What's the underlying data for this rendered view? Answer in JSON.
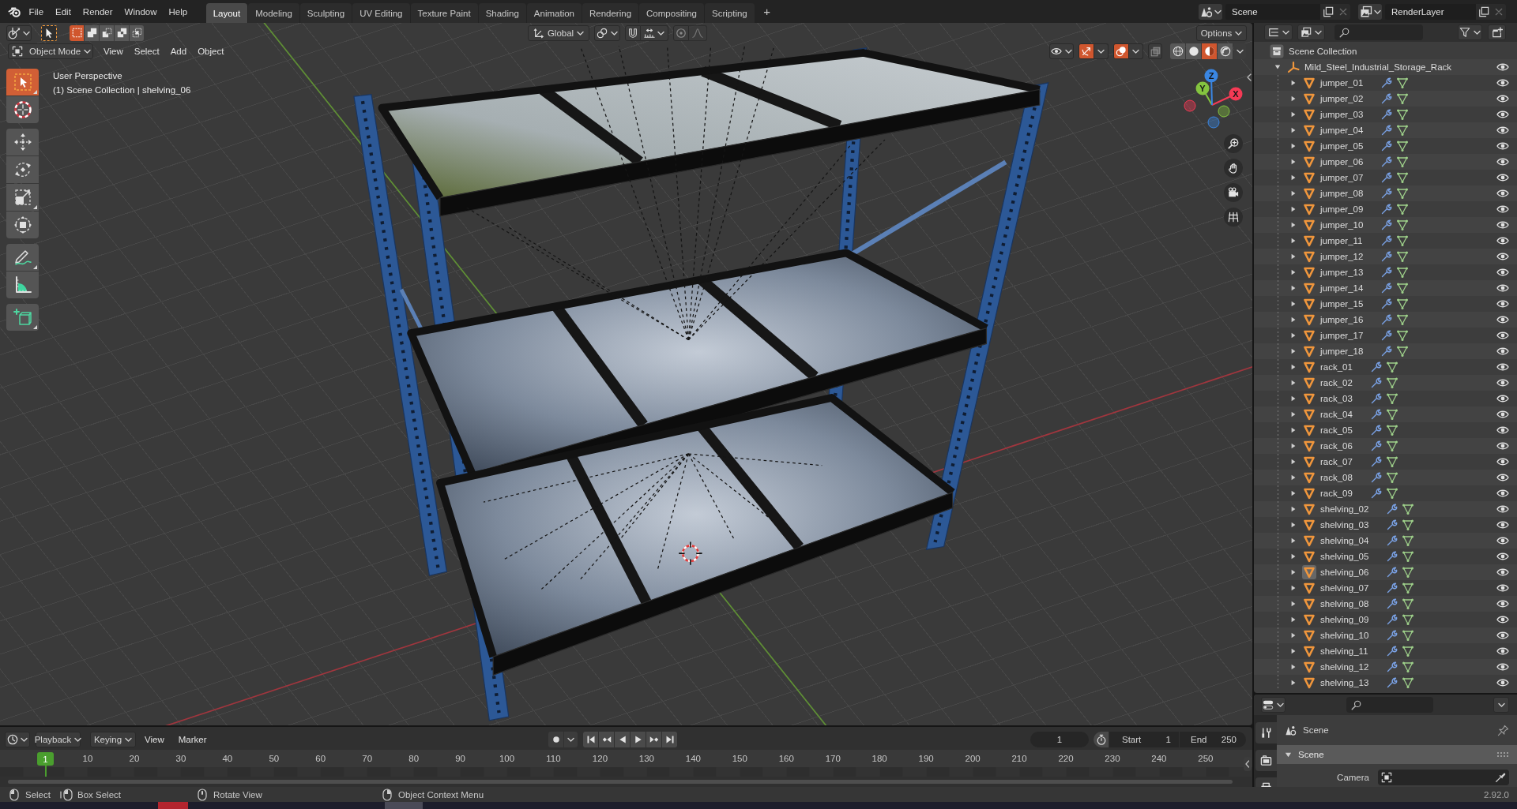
{
  "top_bar": {
    "menus": [
      "File",
      "Edit",
      "Render",
      "Window",
      "Help"
    ],
    "workspaces": [
      {
        "label": "Layout",
        "selected": true
      },
      {
        "label": "Modeling",
        "selected": false
      },
      {
        "label": "Sculpting",
        "selected": false
      },
      {
        "label": "UV Editing",
        "selected": false
      },
      {
        "label": "Texture Paint",
        "selected": false
      },
      {
        "label": "Shading",
        "selected": false
      },
      {
        "label": "Animation",
        "selected": false
      },
      {
        "label": "Rendering",
        "selected": false
      },
      {
        "label": "Compositing",
        "selected": false
      },
      {
        "label": "Scripting",
        "selected": false
      }
    ],
    "add_workspace": "+",
    "scene": "Scene",
    "view_layer": "RenderLayer"
  },
  "viewport": {
    "tool_header": {
      "select_modes": [
        {
          "kind": "set",
          "selected": true
        },
        {
          "kind": "extend",
          "selected": false
        },
        {
          "kind": "subtract",
          "selected": false
        },
        {
          "kind": "invert",
          "selected": false
        },
        {
          "kind": "intersect",
          "selected": false
        }
      ],
      "orientation": "Global",
      "snapping": false,
      "proportional_editing": false,
      "options": "Options"
    },
    "header": {
      "mode": "Object Mode",
      "menus": [
        "View",
        "Select",
        "Add",
        "Object"
      ],
      "gizmos": true,
      "overlays": true,
      "xray": false,
      "shading": [
        {
          "kind": "wireframe",
          "selected": false
        },
        {
          "kind": "solid",
          "selected": false
        },
        {
          "kind": "material",
          "selected": true
        },
        {
          "kind": "rendered",
          "selected": false
        }
      ]
    },
    "info": [
      "User Perspective",
      "(1) Scene Collection | shelving_06"
    ],
    "toolbar": [
      {
        "tools": [
          {
            "kind": "select_box",
            "selected": true
          },
          {
            "kind": "cursor",
            "selected": false
          }
        ]
      },
      {
        "tools": [
          {
            "kind": "move",
            "selected": false
          },
          {
            "kind": "rotate",
            "selected": false
          },
          {
            "kind": "scale",
            "selected": false
          },
          {
            "kind": "transform",
            "selected": false
          }
        ]
      },
      {
        "tools": [
          {
            "kind": "annotate",
            "selected": false
          },
          {
            "kind": "measure",
            "selected": false
          }
        ]
      },
      {
        "tools": [
          {
            "kind": "add_cube",
            "selected": false
          }
        ]
      }
    ],
    "gizmo_axes": [
      {
        "kind": "x",
        "label": "X",
        "color": "#f53a55"
      },
      {
        "kind": "y",
        "label": "Y",
        "color": "#84c43f"
      },
      {
        "kind": "z",
        "label": "Z",
        "color": "#3a86e2"
      }
    ],
    "nav_buttons": [
      {
        "kind": "zoom"
      },
      {
        "kind": "pan"
      },
      {
        "kind": "camera"
      },
      {
        "kind": "ortho"
      }
    ]
  },
  "outliner": {
    "root": {
      "name": "Scene Collection",
      "children": [
        {
          "name": "Mild_Steel_Industrial_Storage_Rack",
          "kind": "empty",
          "expanded": true,
          "visible": true,
          "children": [
            {
              "name": "jumper_01",
              "kind": "mesh",
              "expanded": false,
              "active": false,
              "visible": true
            },
            {
              "name": "jumper_02",
              "kind": "mesh",
              "expanded": false,
              "active": false,
              "visible": true
            },
            {
              "name": "jumper_03",
              "kind": "mesh",
              "expanded": false,
              "active": false,
              "visible": true
            },
            {
              "name": "jumper_04",
              "kind": "mesh",
              "expanded": false,
              "active": false,
              "visible": true
            },
            {
              "name": "jumper_05",
              "kind": "mesh",
              "expanded": false,
              "active": false,
              "visible": true
            },
            {
              "name": "jumper_06",
              "kind": "mesh",
              "expanded": false,
              "active": false,
              "visible": true
            },
            {
              "name": "jumper_07",
              "kind": "mesh",
              "expanded": false,
              "active": false,
              "visible": true
            },
            {
              "name": "jumper_08",
              "kind": "mesh",
              "expanded": false,
              "active": false,
              "visible": true
            },
            {
              "name": "jumper_09",
              "kind": "mesh",
              "expanded": false,
              "active": false,
              "visible": true
            },
            {
              "name": "jumper_10",
              "kind": "mesh",
              "expanded": false,
              "active": false,
              "visible": true
            },
            {
              "name": "jumper_11",
              "kind": "mesh",
              "expanded": false,
              "active": false,
              "visible": true
            },
            {
              "name": "jumper_12",
              "kind": "mesh",
              "expanded": false,
              "active": false,
              "visible": true
            },
            {
              "name": "jumper_13",
              "kind": "mesh",
              "expanded": false,
              "active": false,
              "visible": true
            },
            {
              "name": "jumper_14",
              "kind": "mesh",
              "expanded": false,
              "active": false,
              "visible": true
            },
            {
              "name": "jumper_15",
              "kind": "mesh",
              "expanded": false,
              "active": false,
              "visible": true
            },
            {
              "name": "jumper_16",
              "kind": "mesh",
              "expanded": false,
              "active": false,
              "visible": true
            },
            {
              "name": "jumper_17",
              "kind": "mesh",
              "expanded": false,
              "active": false,
              "visible": true
            },
            {
              "name": "jumper_18",
              "kind": "mesh",
              "expanded": false,
              "active": false,
              "visible": true
            },
            {
              "name": "rack_01",
              "kind": "mesh",
              "expanded": false,
              "active": false,
              "visible": true
            },
            {
              "name": "rack_02",
              "kind": "mesh",
              "expanded": false,
              "active": false,
              "visible": true
            },
            {
              "name": "rack_03",
              "kind": "mesh",
              "expanded": false,
              "active": false,
              "visible": true
            },
            {
              "name": "rack_04",
              "kind": "mesh",
              "expanded": false,
              "active": false,
              "visible": true
            },
            {
              "name": "rack_05",
              "kind": "mesh",
              "expanded": false,
              "active": false,
              "visible": true
            },
            {
              "name": "rack_06",
              "kind": "mesh",
              "expanded": false,
              "active": false,
              "visible": true
            },
            {
              "name": "rack_07",
              "kind": "mesh",
              "expanded": false,
              "active": false,
              "visible": true
            },
            {
              "name": "rack_08",
              "kind": "mesh",
              "expanded": false,
              "active": false,
              "visible": true
            },
            {
              "name": "rack_09",
              "kind": "mesh",
              "expanded": false,
              "active": false,
              "visible": true
            },
            {
              "name": "shelving_02",
              "kind": "mesh",
              "expanded": false,
              "active": false,
              "visible": true
            },
            {
              "name": "shelving_03",
              "kind": "mesh",
              "expanded": false,
              "active": false,
              "visible": true
            },
            {
              "name": "shelving_04",
              "kind": "mesh",
              "expanded": false,
              "active": false,
              "visible": true
            },
            {
              "name": "shelving_05",
              "kind": "mesh",
              "expanded": false,
              "active": false,
              "visible": true
            },
            {
              "name": "shelving_06",
              "kind": "mesh",
              "expanded": false,
              "active": true,
              "visible": true
            },
            {
              "name": "shelving_07",
              "kind": "mesh",
              "expanded": false,
              "active": false,
              "visible": true
            },
            {
              "name": "shelving_08",
              "kind": "mesh",
              "expanded": false,
              "active": false,
              "visible": true
            },
            {
              "name": "shelving_09",
              "kind": "mesh",
              "expanded": false,
              "active": false,
              "visible": true
            },
            {
              "name": "shelving_10",
              "kind": "mesh",
              "expanded": false,
              "active": false,
              "visible": true
            },
            {
              "name": "shelving_11",
              "kind": "mesh",
              "expanded": false,
              "active": false,
              "visible": true
            },
            {
              "name": "shelving_12",
              "kind": "mesh",
              "expanded": false,
              "active": false,
              "visible": true
            },
            {
              "name": "shelving_13",
              "kind": "mesh",
              "expanded": false,
              "active": false,
              "visible": true
            }
          ]
        }
      ]
    }
  },
  "properties": {
    "tabs": [
      {
        "kind": "tool",
        "selected": false
      },
      {
        "kind": "render",
        "selected": false
      },
      {
        "kind": "output",
        "selected": false
      }
    ],
    "context": "Scene",
    "panel": {
      "title": "Scene",
      "expanded": true
    },
    "fields": [
      {
        "label": "Camera"
      }
    ]
  },
  "timeline": {
    "menus": [
      {
        "kind": "dropdown",
        "label": "Playback"
      },
      {
        "kind": "dropdown",
        "label": "Keying"
      },
      {
        "kind": "menu",
        "label": "View"
      },
      {
        "kind": "menu",
        "label": "Marker"
      }
    ],
    "auto_keying": false,
    "current_frame": "1",
    "start": {
      "label": "Start",
      "value": "1"
    },
    "end": {
      "label": "End",
      "value": "250"
    },
    "playhead": "1",
    "frame_labels": [
      "10",
      "20",
      "30",
      "40",
      "50",
      "60",
      "70",
      "80",
      "90",
      "100",
      "110",
      "120",
      "130",
      "140",
      "150",
      "160",
      "170",
      "180",
      "190",
      "200",
      "210",
      "220",
      "230",
      "240",
      "250"
    ]
  },
  "status_bar": {
    "hints": [
      {
        "kind": "left_click",
        "label": "Select"
      },
      {
        "kind": "left_drag",
        "label": "Box Select"
      },
      {
        "kind": "middle_drag",
        "label": "Rotate View"
      },
      {
        "kind": "right_click",
        "label": "Object Context Menu"
      }
    ],
    "version": "2.92.0"
  },
  "taskbar": {
    "items": [
      {
        "color": "#b3252e"
      },
      {
        "color": "#4a4a57"
      }
    ]
  }
}
